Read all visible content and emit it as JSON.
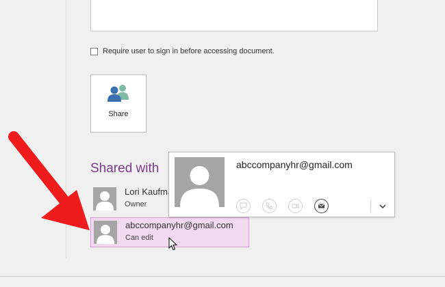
{
  "options": {
    "require_signin_label": "Require user to sign in before accessing document.",
    "require_signin_checked": false
  },
  "share_button": {
    "label": "Share",
    "icon": "people-icon"
  },
  "shared_with": {
    "heading": "Shared with",
    "people": [
      {
        "name": "Lori Kaufman",
        "role": "Owner"
      },
      {
        "name": "abccompanyhr@gmail.com",
        "role": "Can edit"
      }
    ]
  },
  "contact_card": {
    "email": "abccompanyhr@gmail.com",
    "actions": [
      "chat-icon",
      "phone-icon",
      "video-icon",
      "email-icon"
    ],
    "active_action": "email-icon"
  },
  "colors": {
    "heading": "#7a3a8a",
    "selected_row": "#f1d9f0",
    "arrow": "#ee1c1c"
  }
}
